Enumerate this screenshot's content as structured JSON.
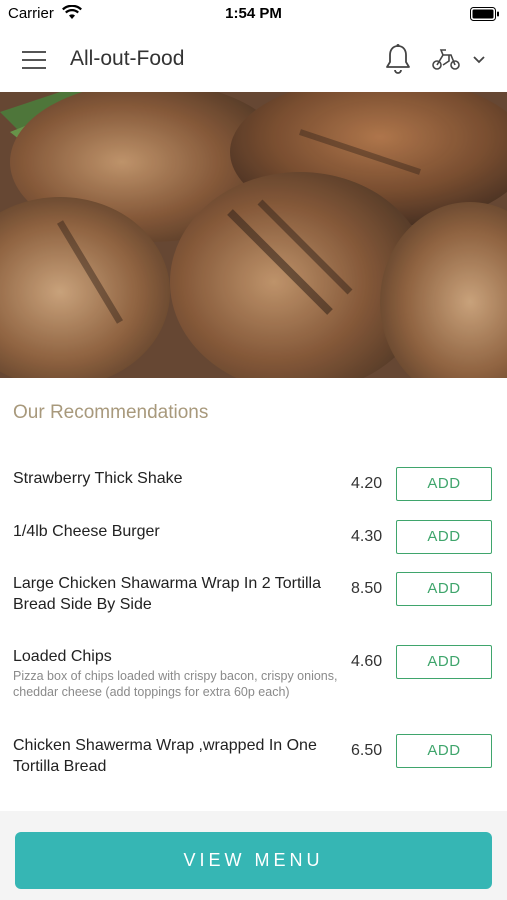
{
  "status_bar": {
    "carrier": "Carrier",
    "time": "1:54 PM"
  },
  "header": {
    "title": "All-out-Food",
    "icons": [
      "menu-icon",
      "bell-icon",
      "delivery-icon",
      "chevron-down-icon"
    ]
  },
  "hero": {
    "image": "grilled-chicken-photo"
  },
  "recommendations": {
    "title": "Our Recommendations",
    "add_label": "ADD",
    "items": [
      {
        "name": "Strawberry Thick Shake",
        "description": "",
        "price": "4.20"
      },
      {
        "name": "1/4lb Cheese Burger",
        "description": "",
        "price": "4.30"
      },
      {
        "name": "Large Chicken Shawarma Wrap In 2 Tortilla Bread Side By Side",
        "description": "",
        "price": "8.50"
      },
      {
        "name": "Loaded Chips",
        "description": "Pizza box of chips loaded with crispy bacon, crispy onions, cheddar cheese (add toppings for extra 60p each)",
        "price": "4.60"
      },
      {
        "name": "Chicken Shawerma Wrap ,wrapped In One Tortilla Bread",
        "description": "",
        "price": "6.50"
      }
    ]
  },
  "footer": {
    "view_menu_label": "VIEW MENU"
  },
  "colors": {
    "accent_teal": "#36b6b4",
    "add_green": "#3fa56c",
    "section_title": "#a8997c"
  }
}
